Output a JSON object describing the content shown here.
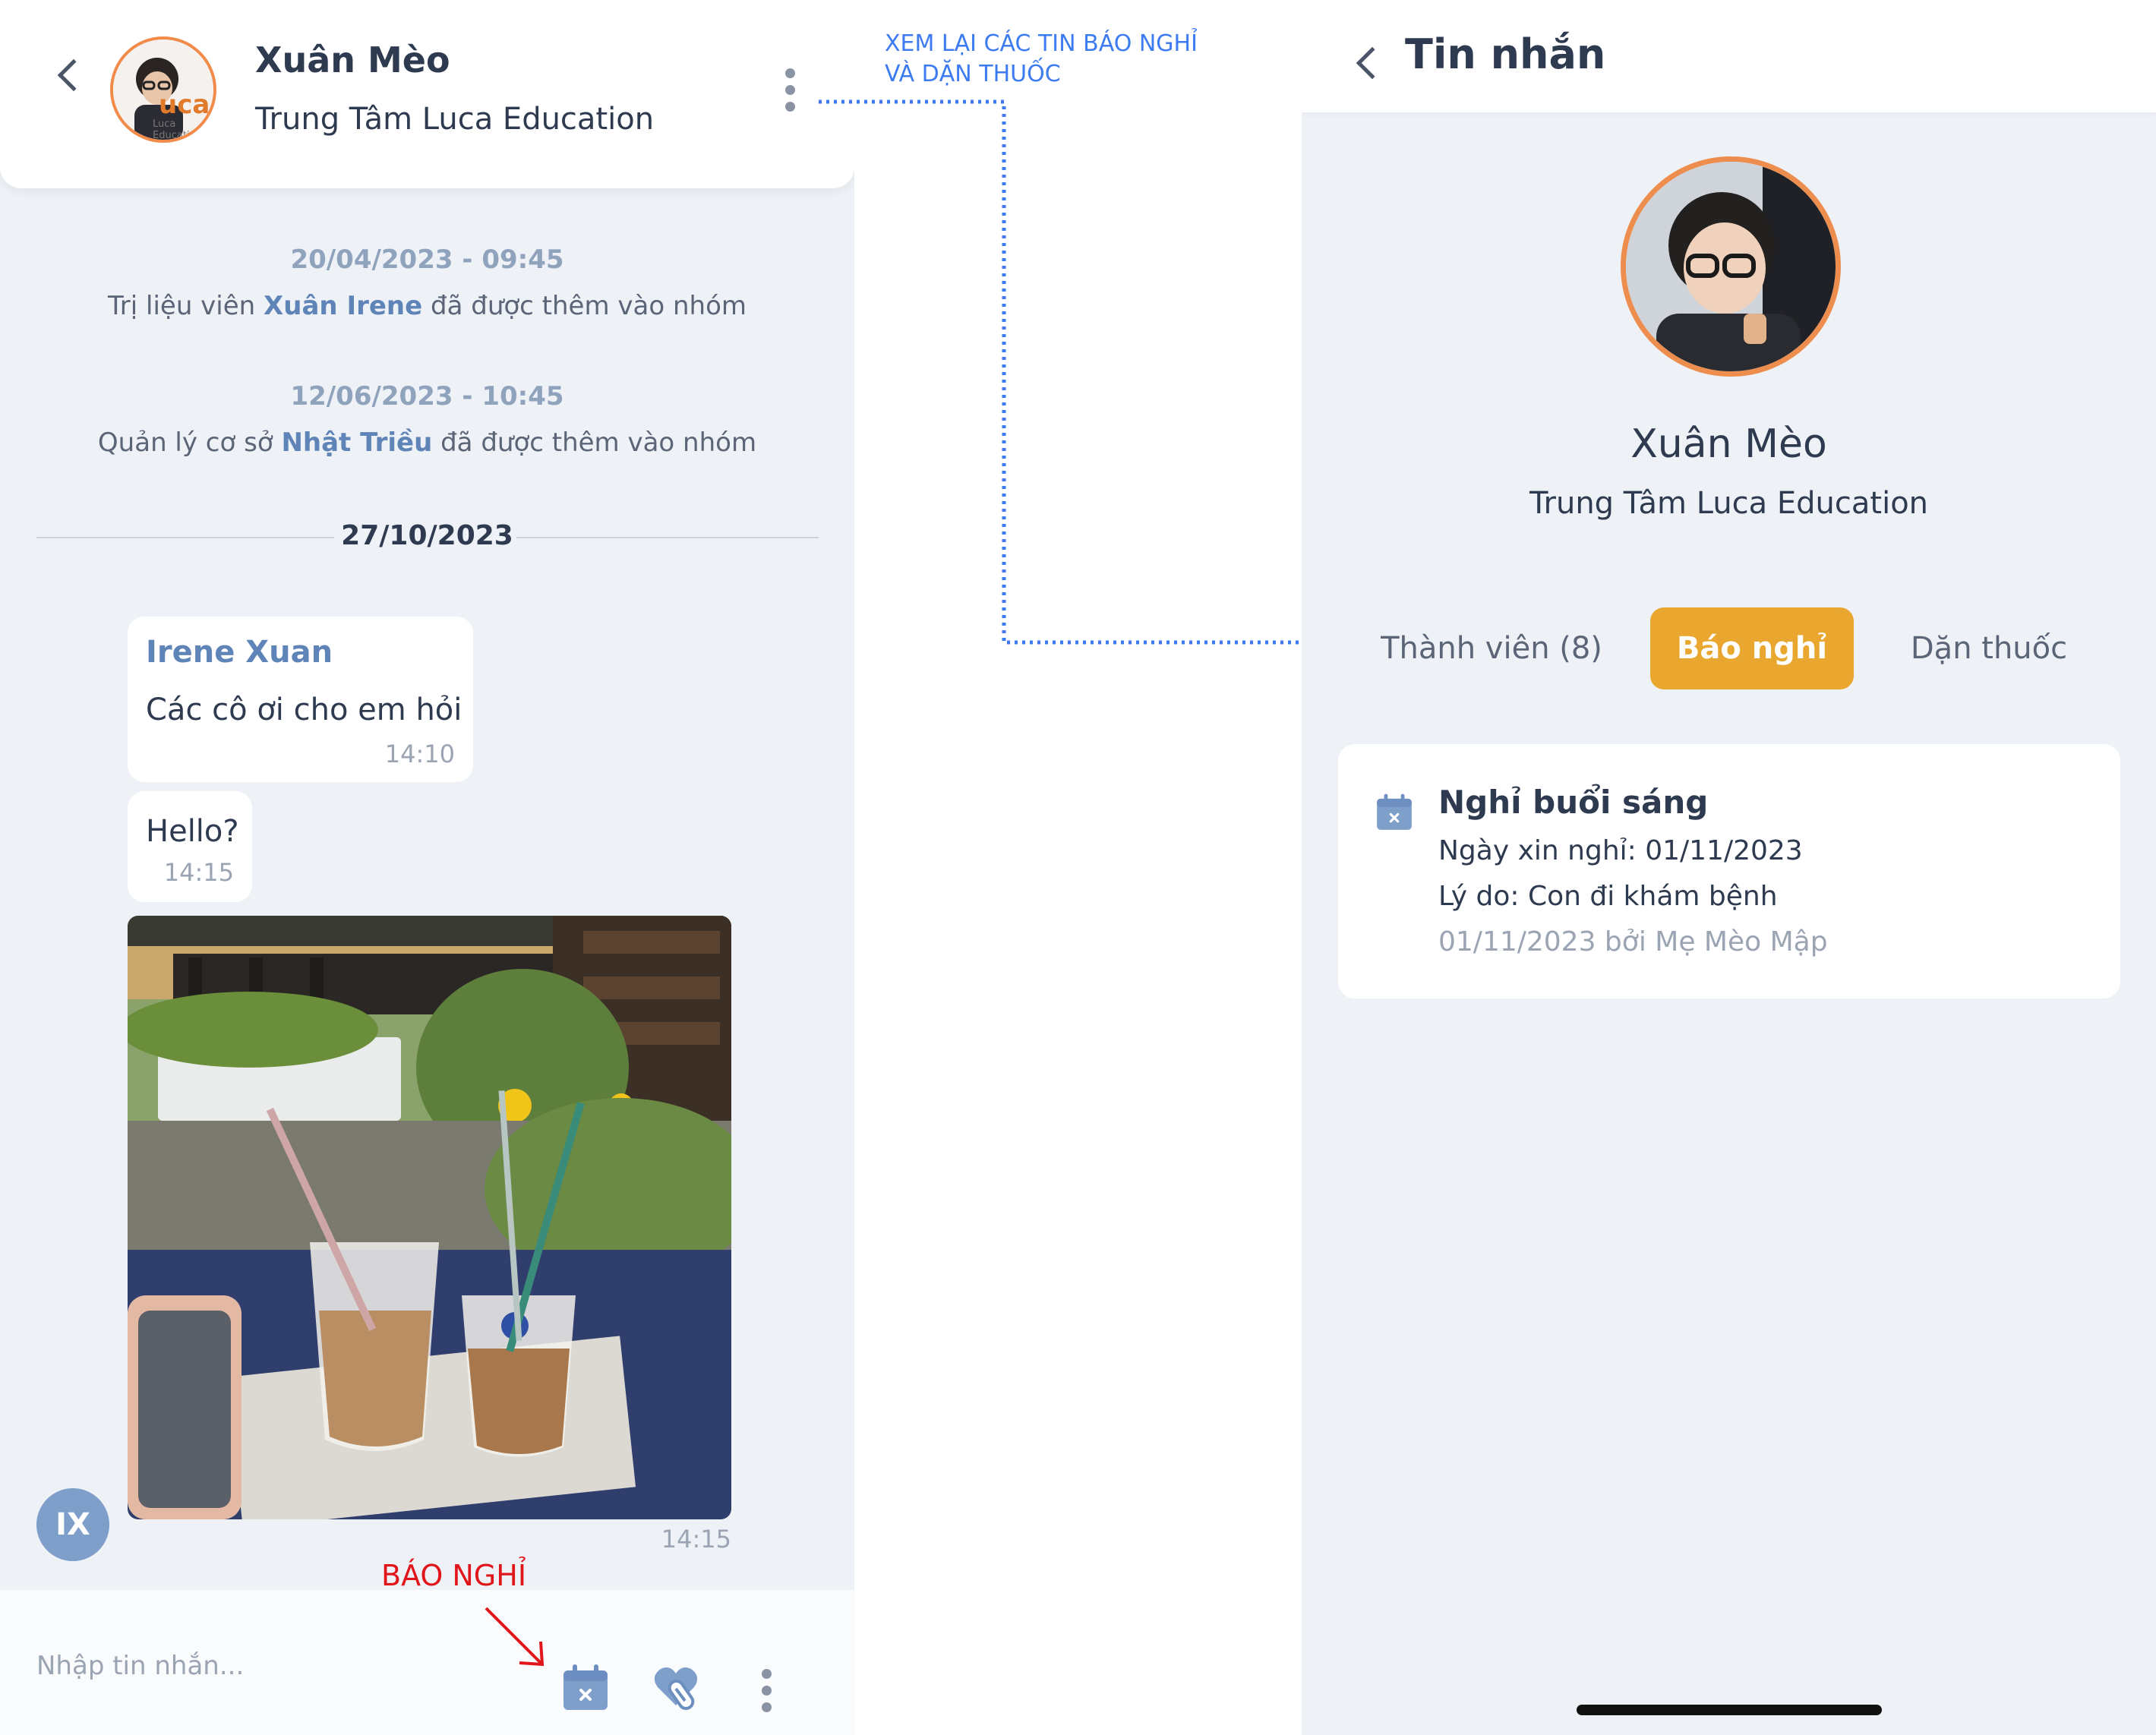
{
  "left": {
    "header": {
      "name": "Xuân Mèo",
      "center": "Trung Tâm Luca Education",
      "logo_text": "uca",
      "logo_caption": "Luca Education"
    },
    "system_messages": [
      {
        "date": "20/04/2023 - 09:45",
        "prefix": "Trị liệu viên",
        "person": "Xuân Irene",
        "suffix": "đã được thêm vào nhóm"
      },
      {
        "date": "12/06/2023 - 10:45",
        "prefix": "Quản lý cơ sở",
        "person": "Nhật Triều",
        "suffix": "đã được thêm vào nhóm"
      }
    ],
    "divider_date": "27/10/2023",
    "messages": [
      {
        "sender": "Irene Xuan",
        "text": "Các cô ơi cho em hỏi",
        "time": "14:10"
      },
      {
        "text": "Hello?",
        "time": "14:15"
      },
      {
        "image": "iced-coffee-photo",
        "time": "14:15"
      }
    ],
    "sender_avatar_initials": "IX",
    "input_placeholder": "Nhập tin nhắn..."
  },
  "annotations": {
    "top_line1": "XEM LẠI CÁC TIN BÁO NGHỈ",
    "top_line2": "VÀ DẶN THUỐC",
    "bottom": "BÁO NGHỈ"
  },
  "right": {
    "title": "Tin nhắn",
    "profile_name": "Xuân Mèo",
    "profile_center": "Trung Tâm Luca Education",
    "tabs": [
      {
        "label": "Thành viên (8)",
        "active": false
      },
      {
        "label": "Báo nghỉ",
        "active": true
      },
      {
        "label": "Dặn thuốc",
        "active": false
      }
    ],
    "leave_card": {
      "title": "Nghỉ buổi sáng",
      "date_line": "Ngày xin nghỉ: 01/11/2023",
      "reason_line": "Lý do: Con đi khám bệnh",
      "meta_line": "01/11/2023 bởi Mẹ Mèo Mập"
    }
  },
  "colors": {
    "accent_orange": "#eaa72f",
    "name_blue": "#5e84b8",
    "annotation_blue": "#3d7bf1",
    "annotation_red": "#e0161b",
    "background": "#eef1f6"
  }
}
